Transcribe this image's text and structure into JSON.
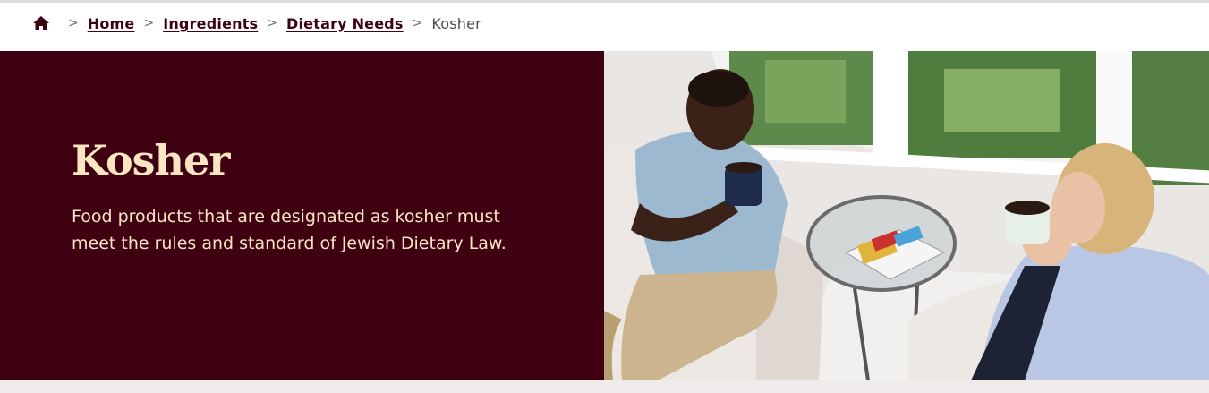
{
  "breadcrumb": {
    "home_icon": "home-icon",
    "separator": ">",
    "items": [
      {
        "label": "Home"
      },
      {
        "label": "Ingredients"
      },
      {
        "label": "Dietary Needs"
      }
    ],
    "current": "Kosher"
  },
  "hero": {
    "title": "Kosher",
    "description": "Food products that are designated as kosher must meet the rules and standard of Jewish Dietary Law.",
    "background_color": "#3f0111",
    "text_color": "#fbe5c3"
  }
}
